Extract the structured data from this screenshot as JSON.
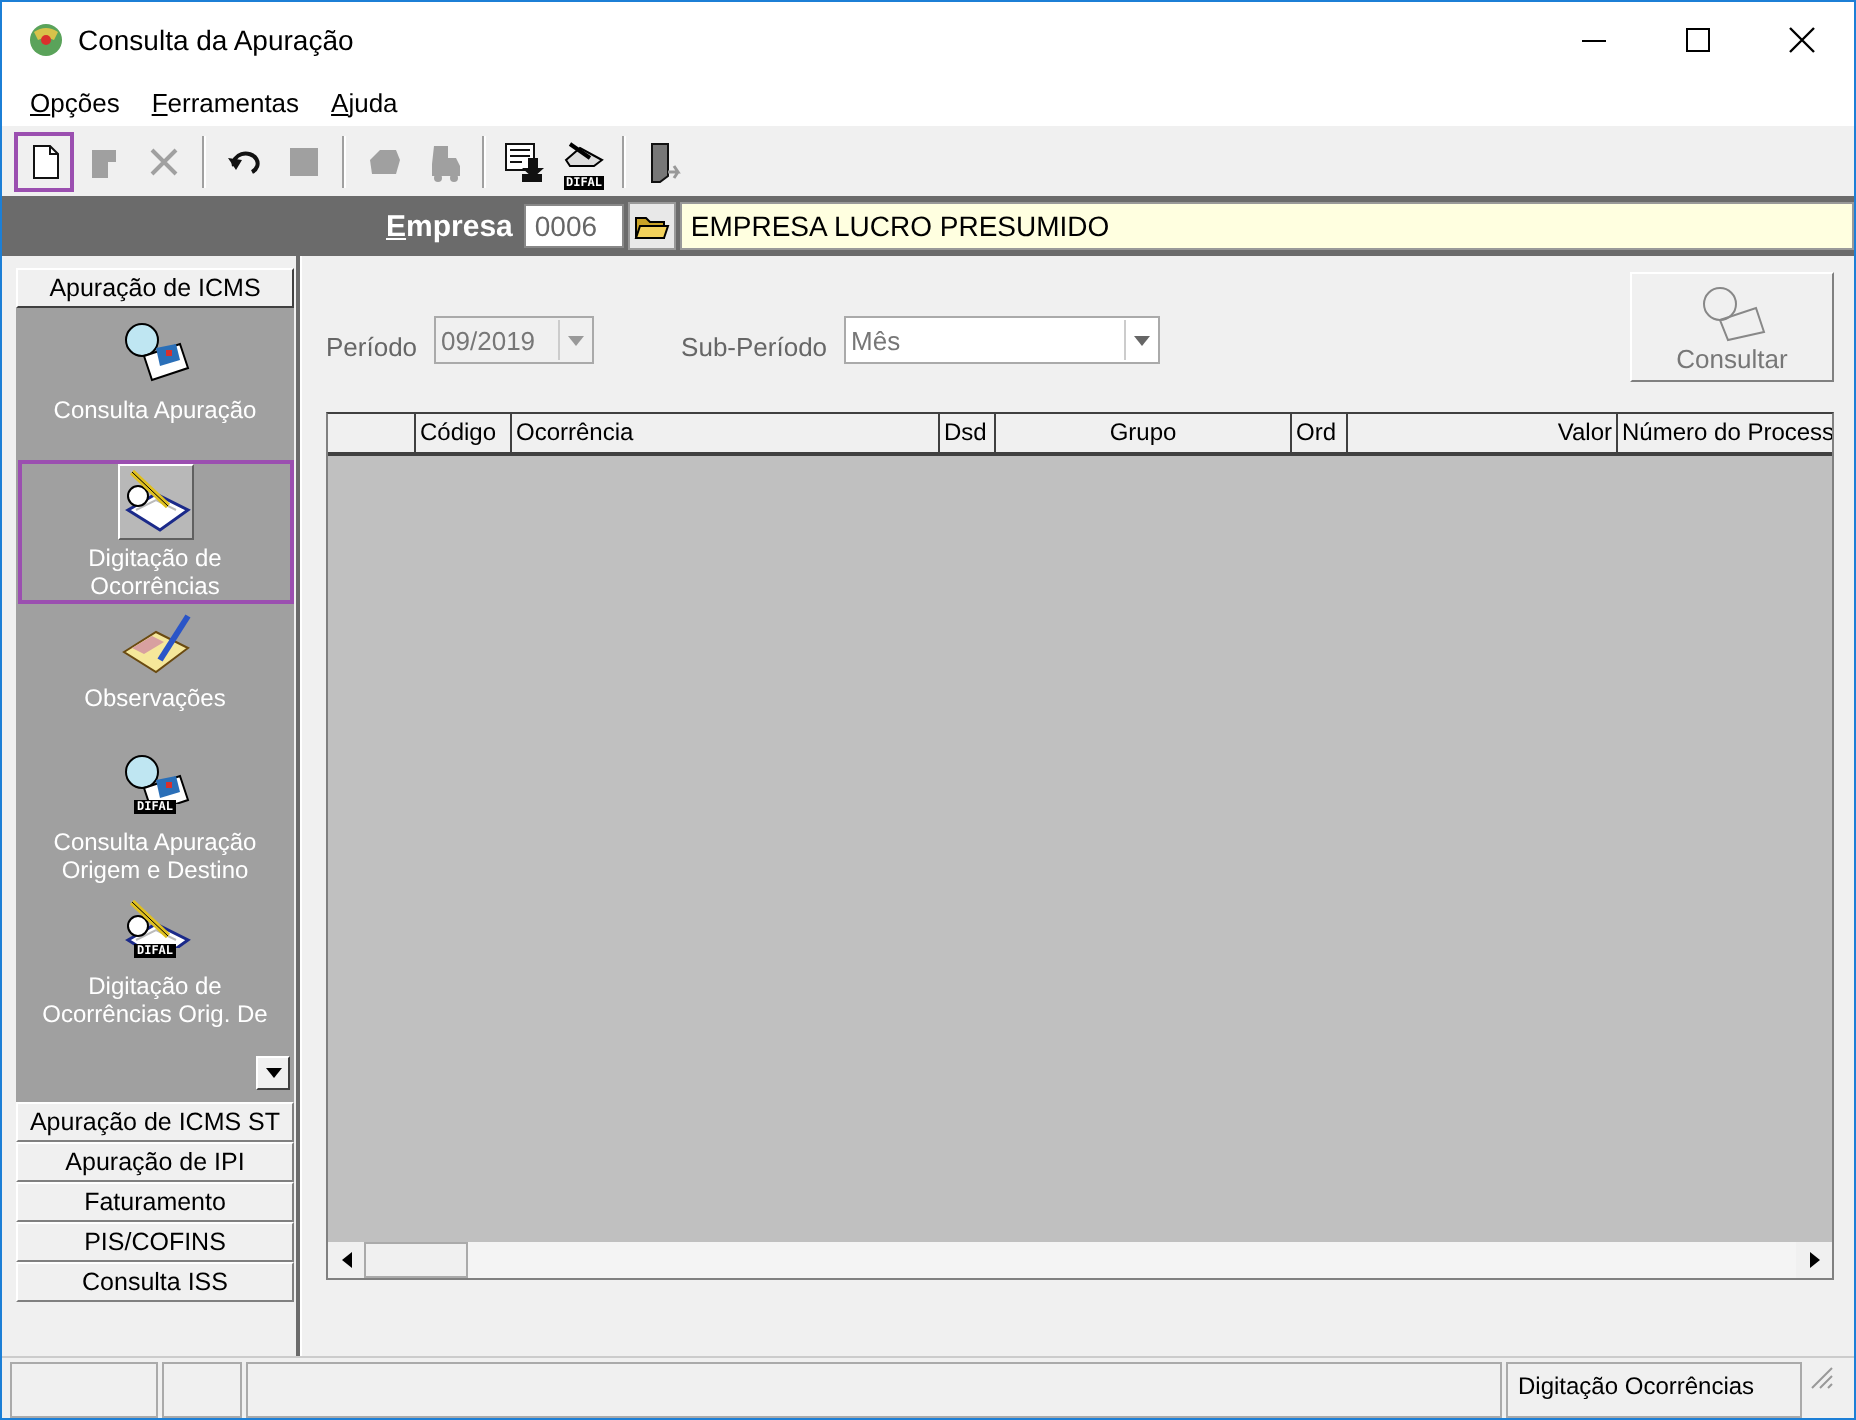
{
  "window": {
    "title": "Consulta da Apuração"
  },
  "menu": [
    "Opções",
    "Ferramentas",
    "Ajuda"
  ],
  "toolbar": [
    {
      "kind": "new",
      "disabled": false,
      "selected": true
    },
    {
      "kind": "edit",
      "disabled": true,
      "selected": false
    },
    {
      "kind": "delete",
      "disabled": true,
      "selected": false
    },
    {
      "kind": "separator"
    },
    {
      "kind": "undo",
      "disabled": false,
      "selected": false
    },
    {
      "kind": "stop",
      "disabled": true,
      "selected": false
    },
    {
      "kind": "separator"
    },
    {
      "kind": "print",
      "disabled": true,
      "selected": false
    },
    {
      "kind": "truck",
      "disabled": true,
      "selected": false
    },
    {
      "kind": "separator"
    },
    {
      "kind": "export",
      "disabled": false,
      "selected": false
    },
    {
      "kind": "difal",
      "badge": "DIFAL",
      "disabled": false,
      "selected": false
    },
    {
      "kind": "separator"
    },
    {
      "kind": "exit",
      "disabled": false,
      "selected": false
    }
  ],
  "company": {
    "label": "Empresa",
    "code": "0006",
    "name": "EMPRESA LUCRO PRESUMIDO"
  },
  "sidebar": {
    "sections": [
      {
        "label": "Apuração de ICMS",
        "expanded": true,
        "items": [
          {
            "kind": "query",
            "label": "Consulta Apuração",
            "selected": false
          },
          {
            "kind": "entry",
            "label": "Digitação de Ocorrências",
            "selected": true
          },
          {
            "kind": "notes",
            "label": "Observações",
            "selected": false
          },
          {
            "kind": "query",
            "badge": "DIFAL",
            "label": "Consulta Apuração Origem e Destino",
            "selected": false
          },
          {
            "kind": "entry",
            "badge": "DIFAL",
            "label": "Digitação de Ocorrências Orig. De",
            "selected": false
          }
        ]
      },
      {
        "label": "Apuração de ICMS ST",
        "expanded": false
      },
      {
        "label": "Apuração de IPI",
        "expanded": false
      },
      {
        "label": "Faturamento",
        "expanded": false
      },
      {
        "label": "PIS/COFINS",
        "expanded": false
      },
      {
        "label": "Consulta ISS",
        "expanded": false
      }
    ]
  },
  "filters": [
    {
      "label": "Período",
      "value": "09/2019",
      "disabled": true
    },
    {
      "label": "Sub-Período",
      "value": "Mês",
      "disabled": false
    }
  ],
  "consult_button": {
    "label": "Consultar",
    "disabled": true
  },
  "table": {
    "columns": [
      {
        "label": "Código"
      },
      {
        "label": "Ocorrência"
      },
      {
        "label": "Dsd"
      },
      {
        "label": "Grupo"
      },
      {
        "label": "Ord"
      },
      {
        "label": "Valor"
      },
      {
        "label": "Número do Process"
      }
    ]
  },
  "status_bar": {
    "message": "Digitação Ocorrências"
  }
}
